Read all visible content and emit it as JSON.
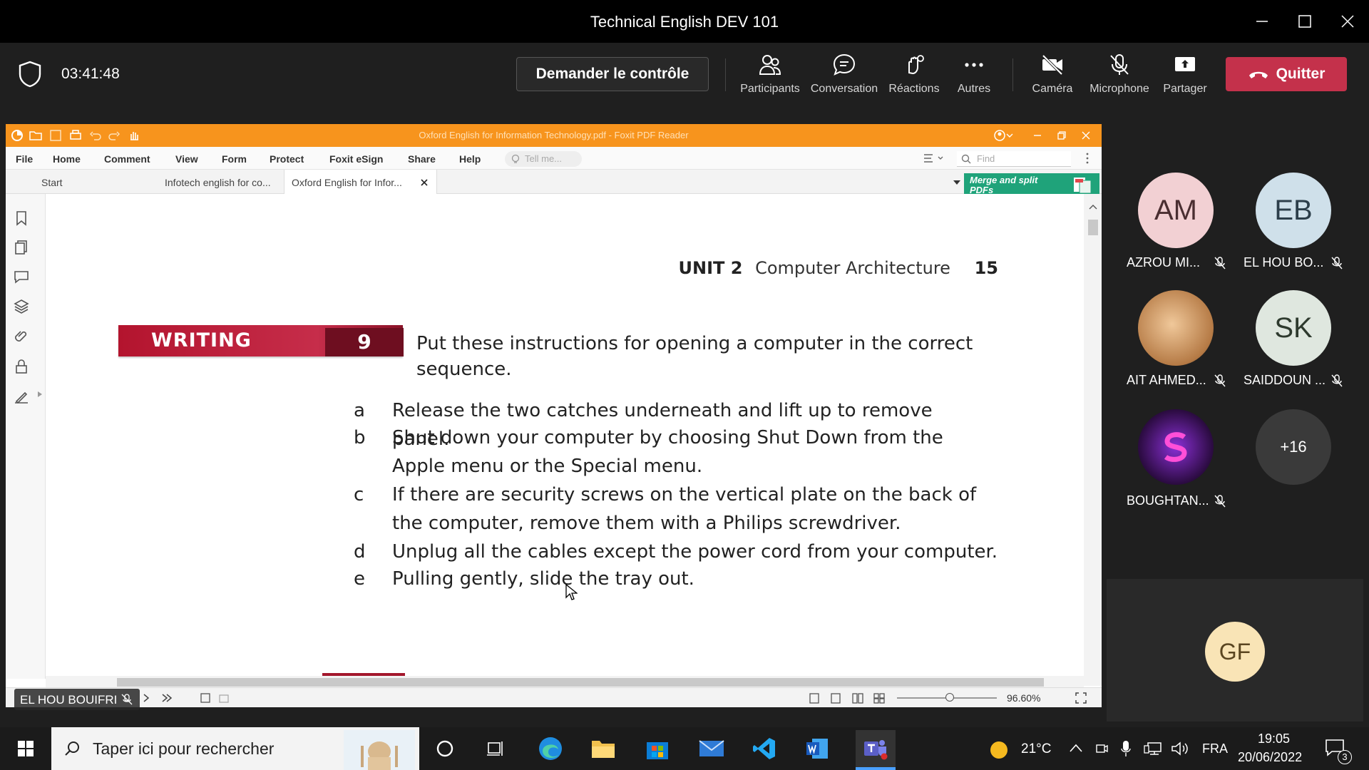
{
  "window": {
    "title": "Technical English DEV 101"
  },
  "meeting": {
    "timer": "03:41:48",
    "ask_control": "Demander le contrôle",
    "buttons": {
      "participants": "Participants",
      "conversation": "Conversation",
      "reactions": "Réactions",
      "more": "Autres",
      "camera": "Caméra",
      "microphone": "Microphone",
      "share": "Partager"
    },
    "quit": "Quitter"
  },
  "foxit": {
    "title": "Oxford English for Information Technology.pdf - Foxit PDF Reader",
    "menu": [
      "File",
      "Home",
      "Comment",
      "View",
      "Form",
      "Protect",
      "Foxit eSign",
      "Share",
      "Help"
    ],
    "tell_me": "Tell me...",
    "find": "Find",
    "tabs": [
      "Start",
      "Infotech english for co...",
      "Oxford English for Infor..."
    ],
    "merge_banner": "Merge and split PDFs",
    "zoom": "96.60%"
  },
  "document": {
    "unit": "UNIT 2",
    "unit_title": "Computer Architecture",
    "page_number": "15",
    "section": "WRITING",
    "exercise_number": "9",
    "instruction": "Put these instructions for opening a computer in the correct sequence.",
    "items": [
      {
        "letter": "a",
        "text": "Release the two catches underneath and lift up to remove panel."
      },
      {
        "letter": "b",
        "text": "Shut down your computer by choosing Shut Down from the Apple menu or the Special menu."
      },
      {
        "letter": "c",
        "text": "If there are security screws on the vertical plate on the back of the computer, remove them with a Philips screwdriver."
      },
      {
        "letter": "d",
        "text": "Unplug all the cables except the power cord from your computer."
      },
      {
        "letter": "e",
        "text": "Pulling gently, slide the tray out."
      }
    ]
  },
  "participants": [
    {
      "initials": "AM",
      "name": "AZROU MI...",
      "color": "#f2d0d3"
    },
    {
      "initials": "EB",
      "name": "EL HOU BO...",
      "color": "#cfe0ea"
    },
    {
      "initials": "",
      "name": "AIT AHMED...",
      "color": "#c9935f"
    },
    {
      "initials": "SK",
      "name": "SAIDDOUN ...",
      "color": "#dfe7df"
    },
    {
      "initials": "",
      "name": "BOUGHTAN...",
      "color": "#2a0b3f"
    },
    {
      "initials": "+16",
      "name": "",
      "color": "#3a3a3a"
    }
  ],
  "gf_tile": {
    "initials": "GF",
    "color": "#f9e4b6"
  },
  "presenter_tag": "EL HOU BOUIFRI",
  "taskbar": {
    "search_placeholder": "Taper ici pour rechercher",
    "weather": "21°C",
    "language": "FRA",
    "time": "19:05",
    "date": "20/06/2022",
    "notifications": "3"
  }
}
